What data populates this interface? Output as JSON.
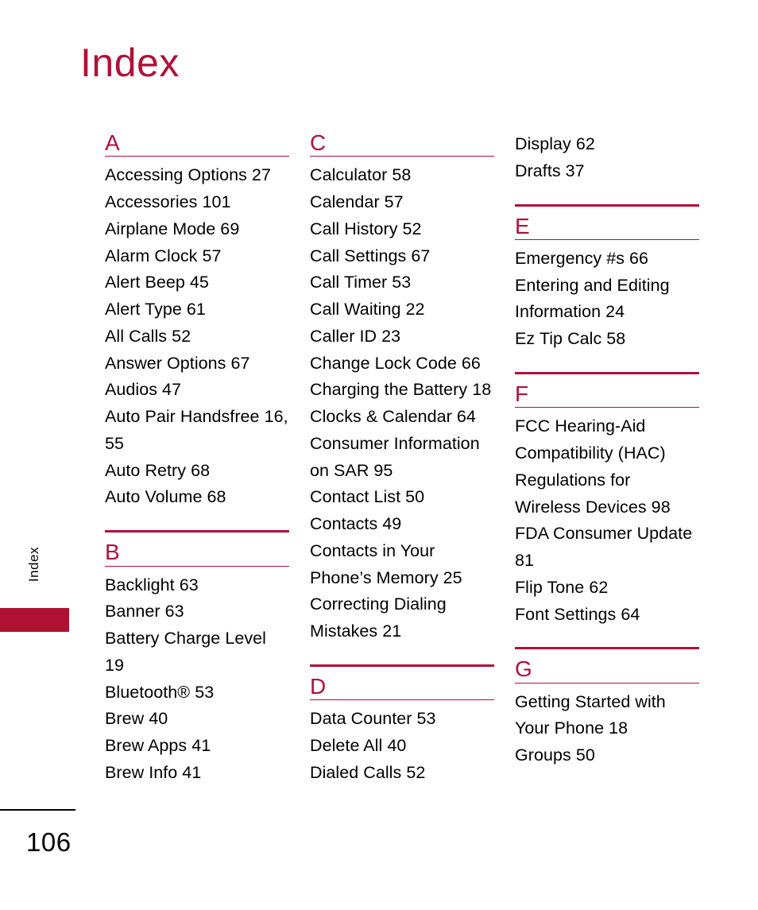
{
  "page": {
    "title": "Index",
    "number": "106",
    "side_tab_label": "Index",
    "accent_color": "#AF1139",
    "tab_color": "#AF1133"
  },
  "columns": [
    {
      "id": "column-1",
      "continuation_entries": [],
      "sections": [
        {
          "letter": "A",
          "top_rule": false,
          "entries": [
            "Accessing Options 27",
            "Accessories 101",
            "Airplane Mode 69",
            "Alarm Clock 57",
            "Alert Beep 45",
            "Alert Type 61",
            "All Calls 52",
            "Answer Options 67",
            "Audios 47",
            "Auto Pair Handsfree 16, 55",
            "Auto Retry 68",
            "Auto Volume 68"
          ]
        },
        {
          "letter": "B",
          "top_rule": true,
          "entries": [
            "Backlight 63",
            "Banner 63",
            "Battery Charge Level 19",
            "Bluetooth® 53",
            "Brew 40",
            "Brew Apps 41",
            "Brew Info 41"
          ]
        }
      ]
    },
    {
      "id": "column-2",
      "continuation_entries": [],
      "sections": [
        {
          "letter": "C",
          "top_rule": false,
          "entries": [
            "Calculator 58",
            "Calendar 57",
            "Call History 52",
            "Call Settings 67",
            "Call Timer 53",
            "Call Waiting 22",
            "Caller ID 23",
            "Change Lock Code 66",
            "Charging the Battery 18",
            "Clocks & Calendar 64",
            "Consumer Information on SAR 95",
            "Contact List 50",
            "Contacts 49",
            "Contacts in Your Phone’s Memory 25",
            "Correcting Dialing Mistakes 21"
          ]
        },
        {
          "letter": "D",
          "top_rule": true,
          "entries": [
            "Data Counter 53",
            "Delete All 40",
            "Dialed Calls 52"
          ]
        }
      ]
    },
    {
      "id": "column-3",
      "continuation_entries": [
        "Display 62",
        "Drafts 37"
      ],
      "sections": [
        {
          "letter": "E",
          "top_rule": true,
          "entries": [
            "Emergency #s 66",
            "Entering and Editing Information 24",
            "Ez Tip Calc 58"
          ]
        },
        {
          "letter": "F",
          "top_rule": true,
          "entries": [
            "FCC Hearing-Aid Compatibility (HAC) Regulations for Wireless Devices 98",
            "FDA Consumer Update 81",
            "Flip Tone 62",
            "Font Settings 64"
          ]
        },
        {
          "letter": "G",
          "top_rule": true,
          "entries": [
            "Getting Started with Your Phone 18",
            "Groups 50"
          ]
        }
      ]
    }
  ]
}
